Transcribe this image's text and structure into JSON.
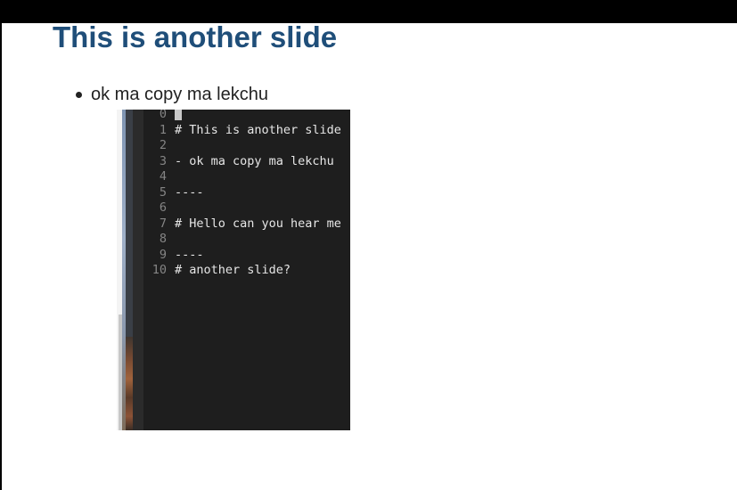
{
  "slide": {
    "title": "This is another slide",
    "bullets": [
      "ok ma copy ma lekchu"
    ]
  },
  "editor_screenshot": {
    "lines": [
      {
        "num": "0",
        "text": ""
      },
      {
        "num": "1",
        "text": "# This is another slide"
      },
      {
        "num": "2",
        "text": ""
      },
      {
        "num": "3",
        "text": "- ok ma copy ma lekchu"
      },
      {
        "num": "4",
        "text": ""
      },
      {
        "num": "5",
        "text": "----"
      },
      {
        "num": "6",
        "text": ""
      },
      {
        "num": "7",
        "text": "# Hello can you hear me"
      },
      {
        "num": "8",
        "text": ""
      },
      {
        "num": "9",
        "text": "----"
      },
      {
        "num": "10",
        "text": "# another slide?"
      }
    ],
    "colors": {
      "background": "#1e1e1e",
      "line_number": "#858585",
      "text": "#e6e6e6"
    }
  },
  "colors": {
    "title": "#1f4e79",
    "body_text": "#222222",
    "top_bar": "#000000"
  }
}
